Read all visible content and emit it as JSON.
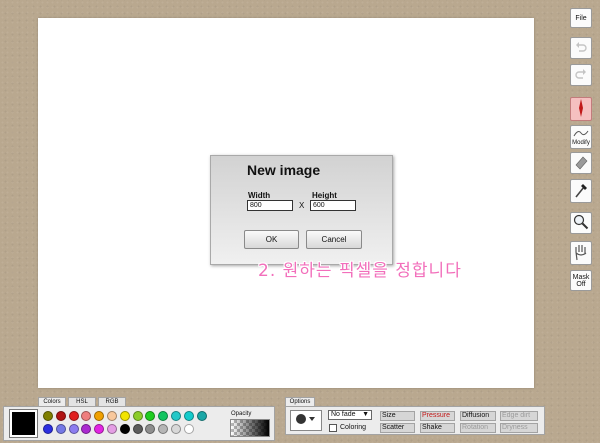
{
  "dialog": {
    "title": "New image",
    "width_label": "Width",
    "width_value": "800",
    "times": "X",
    "height_label": "Height",
    "height_value": "600",
    "ok_label": "OK",
    "cancel_label": "Cancel"
  },
  "annotation": "2. 원하는 픽셀을 정합니다",
  "toolbar": {
    "file_label": "File",
    "modify_label": "Modify",
    "mask_label_1": "Mask",
    "mask_label_2": "Off"
  },
  "colors_panel": {
    "tabs": [
      "Colors",
      "HSL",
      "RGB"
    ],
    "current_color": "#000000",
    "opacity_label": "Opacity",
    "swatches_row1": [
      "#7f7f00",
      "#b01313",
      "#e02020",
      "#ee7d7d",
      "#f0a000",
      "#f8c89c",
      "#f2e400",
      "#8ccc2a",
      "#1fcd1f",
      "#12c460",
      "#25c8c8",
      "#14cccc",
      "#1aa7a7"
    ],
    "swatches_row2": [
      "#2b2ee0",
      "#7478e6",
      "#8c7df0",
      "#aa2ad0",
      "#e224e2",
      "#e49ee4",
      "#000000",
      "#5b5b5b",
      "#8e8e8e",
      "#b5b5b5",
      "#d8d8d8",
      "#ffffff"
    ]
  },
  "options_panel": {
    "tab": "Options",
    "fade_value": "No fade",
    "coloring_label": "Coloring",
    "buttons": {
      "size": "Size",
      "pressure": "Pressure",
      "diffusion": "Diffusion",
      "edge_dirt": "Edge dirt",
      "scatter": "Scatter",
      "shake": "Shake",
      "rotation": "Rotation",
      "dryness": "Dryness"
    }
  }
}
